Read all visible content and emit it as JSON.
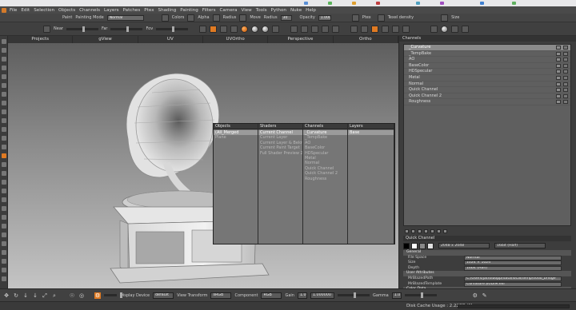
{
  "menu": [
    "File",
    "Edit",
    "Selection",
    "Objects",
    "Channels",
    "Layers",
    "Patches",
    "Ptex",
    "Shading",
    "Painting",
    "Filters",
    "Camera",
    "View",
    "Tools",
    "Python",
    "Nuke",
    "Help"
  ],
  "toolbar_top": {
    "paint_label": "Paint",
    "painting_mode_label": "Painting Mode",
    "painting_mode_value": "Normal",
    "colors_label": "Colors",
    "alpha_label": "Alpha",
    "radius_label": "Radius",
    "move_label": "Move",
    "radius2_label": "Radius",
    "radius2_value": "30",
    "opacity_label": "Opacity",
    "opacity_value": "1.000",
    "ptex_label": "Ptex",
    "texel_density_label": "Texel density",
    "size_label": "Size"
  },
  "toolbar_second": {
    "near_label": "Near",
    "far_label": "Far",
    "fov_label": "Fov"
  },
  "view_tabs": [
    "Projects",
    "gView",
    "UV",
    "UVOrtho",
    "Perspective",
    "Ortho"
  ],
  "popup": {
    "columns": [
      {
        "header": "Objects",
        "items": [
          "(All_Merged",
          "Plane"
        ],
        "selected": 0
      },
      {
        "header": "Shaders",
        "items": [
          "Current Channel",
          "Current Layer",
          "Current Layer & Below",
          "Current Paint Target",
          "Full Shader Preview 2"
        ],
        "selected": 0
      },
      {
        "header": "Channels",
        "items": [
          "_Curvature",
          "_TempBake",
          "AO",
          "BaseColor",
          "HDSpecular",
          "Metal",
          "Normal",
          "Quick Channel",
          "Quick Channel 2",
          "Roughness"
        ],
        "selected": 0
      },
      {
        "header": "Layers",
        "items": [
          "Base"
        ],
        "selected": 0
      }
    ]
  },
  "channels_panel": {
    "title": "Channels",
    "items": [
      "_Curvature",
      "_TempBake",
      "AO",
      "BaseColor",
      "HDSpecular",
      "Metal",
      "Normal",
      "Quick Channel",
      "Quick Channel 2",
      "Roughness"
    ],
    "selected": 0
  },
  "quick_channel": {
    "title": "Quick Channel",
    "size_value": "2048 x 2048",
    "depth_value": "16bit (Half)"
  },
  "properties": [
    {
      "type": "head",
      "label": "General"
    },
    {
      "type": "row",
      "label": "File Space",
      "value": "Normal"
    },
    {
      "type": "row",
      "label": "Size",
      "value": "1024 × 1024"
    },
    {
      "type": "row",
      "label": "Depth",
      "value": "16bit (Half)"
    },
    {
      "type": "head",
      "label": "User Attributes"
    },
    {
      "type": "row",
      "label": "MrBlazedPath",
      "value": "C:/Users/jatrolbopp/data/local/temp/vodo_bridge"
    },
    {
      "type": "row",
      "label": "MrBlazedTemplate",
      "value": "Curvature.$UDIM.exr"
    },
    {
      "type": "head",
      "label": "Color Data"
    },
    {
      "type": "row",
      "label": "Colorspace",
      "value": "Automatic (linear)"
    },
    {
      "type": "row",
      "label": "Raw Data",
      "value": ""
    },
    {
      "type": "row",
      "label": "Scalar Data",
      "value": ""
    },
    {
      "type": "row",
      "label": "Cache Data",
      "value": ""
    }
  ],
  "bottombar": {
    "display_device_label": "Display Device",
    "display_device_value": "default",
    "view_transform_label": "View Transform",
    "view_transform_value": "sRGB",
    "component_label": "Component",
    "component_value": "RGB",
    "gain_label": "Gain",
    "gain_value": "1.0",
    "gain_field": "1.000000",
    "gamma_label": "Gamma",
    "gamma_value": "1.0"
  },
  "status": {
    "cache": "Disk Cache Usage : 2.22GB (Max:..."
  },
  "colors": {
    "accent": "#e07a22",
    "panel": "#3d3d3d",
    "selection": "#8a8a8a"
  }
}
